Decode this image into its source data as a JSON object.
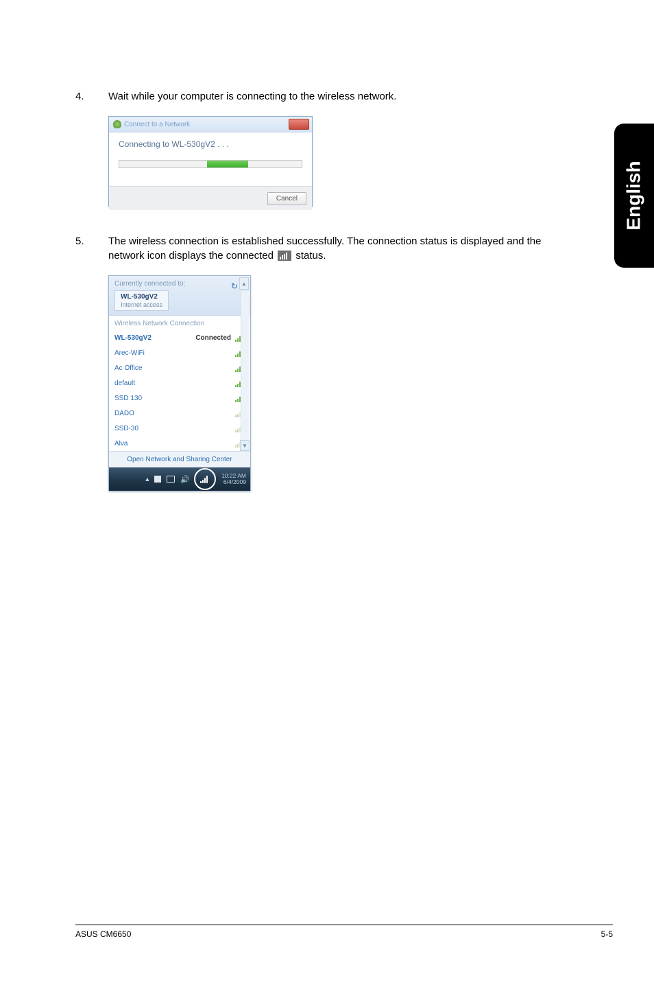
{
  "steps": {
    "s4": {
      "num": "4.",
      "text": "Wait while your computer is connecting to the wireless network."
    },
    "s5": {
      "num": "5.",
      "text_before": "The wireless connection is established successfully. The connection status is displayed and the network icon displays the connected ",
      "text_after": " status."
    }
  },
  "side_tab": "English",
  "footer": {
    "left": "ASUS CM6650",
    "right": "5-5"
  },
  "dialog1": {
    "title": "Connect to a Network",
    "body_label": "Connecting to WL-530gV2 . . .",
    "cancel": "Cancel"
  },
  "popup2": {
    "currently": "Currently connected to:",
    "conn_name": "WL-530gV2",
    "conn_sub": "Internet access",
    "section": "Wireless Network Connection",
    "items": [
      {
        "name": "WL-530gV2",
        "status": "Connected",
        "signal": "full",
        "bold": true
      },
      {
        "name": "Arec-WiFi",
        "signal": "full"
      },
      {
        "name": "Ac Office",
        "signal": "full"
      },
      {
        "name": "default",
        "signal": "med"
      },
      {
        "name": "SSD 130",
        "signal": "med"
      },
      {
        "name": "DADO",
        "signal": "weak"
      },
      {
        "name": "SSD-30",
        "signal": "weak"
      },
      {
        "name": "Alva",
        "signal": "weak"
      }
    ],
    "footer_link": "Open Network and Sharing Center",
    "clock_time": "10:22 AM",
    "clock_date": "6/4/2009"
  }
}
